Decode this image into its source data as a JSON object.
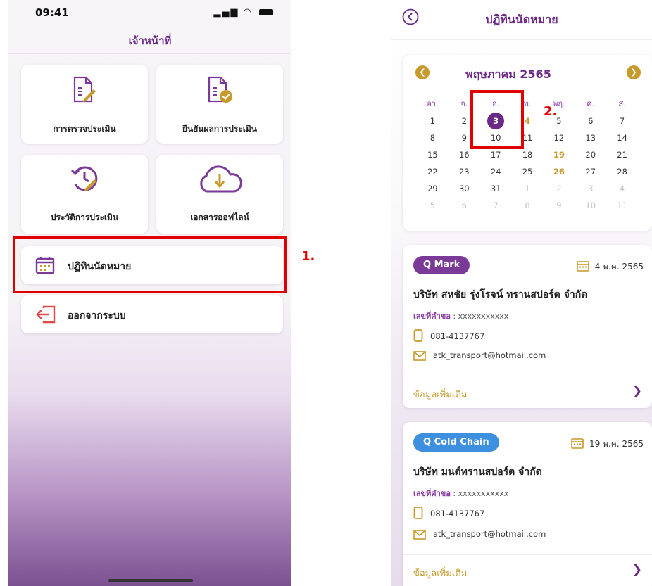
{
  "left": {
    "status_time": "09:41",
    "status_icons": "signal-wifi-battery",
    "header_title": "เจ้าหน้าที่",
    "tiles": [
      {
        "label": "การตรวจประเมิน",
        "icon": "document-edit-icon"
      },
      {
        "label": "ยืนยันผลการประเมิน",
        "icon": "document-check-icon"
      },
      {
        "label": "ประวัติการประเมิน",
        "icon": "history-icon"
      },
      {
        "label": "เอกสารออฟไลน์",
        "icon": "cloud-download-icon"
      }
    ],
    "menu": [
      {
        "label": "ปฏิทินนัดหมาย",
        "icon": "calendar-icon"
      },
      {
        "label": "ออกจากระบบ",
        "icon": "logout-icon"
      }
    ],
    "step_label": "1."
  },
  "right": {
    "header_title": "ปฏิทินนัดหมาย",
    "calendar": {
      "month_title": "พฤษภาคม 2565",
      "weekdays": [
        "อา.",
        "จ.",
        "อ.",
        "พ.",
        "พฤ.",
        "ศ.",
        "ส."
      ],
      "weeks": [
        [
          "1",
          "2",
          "3",
          "4",
          "5",
          "6",
          "7"
        ],
        [
          "8",
          "9",
          "10",
          "11",
          "12",
          "13",
          "14"
        ],
        [
          "15",
          "16",
          "17",
          "18",
          "19",
          "20",
          "21"
        ],
        [
          "22",
          "23",
          "24",
          "25",
          "26",
          "27",
          "28"
        ],
        [
          "29",
          "30",
          "31",
          "1",
          "2",
          "3",
          "4"
        ],
        [
          "5",
          "6",
          "7",
          "8",
          "9",
          "10",
          "11"
        ]
      ],
      "selected_day": "3",
      "event_days": [
        "4",
        "19",
        "26"
      ],
      "step_label": "2."
    },
    "appointments": [
      {
        "badge": "Q Mark",
        "badge_color": "#7b3a98",
        "date": "4 พ.ค. 2565",
        "company": "บริษัท สหชัย รุ่งโรจน์ ทรานสปอร์ต จำกัด",
        "request_label": "เลขที่คำขอ",
        "request_value": " : xxxxxxxxxxx",
        "phone": "081-4137767",
        "email": "atk_transport@hotmail.com",
        "more": "ข้อมูลเพิ่มเติม"
      },
      {
        "badge": "Q Cold Chain",
        "badge_color": "#3d8fe0",
        "date": "19 พ.ค. 2565",
        "company": "บริษัท มนต์ทรานสปอร์ต จำกัด",
        "request_label": "เลขที่คำขอ",
        "request_value": " : xxxxxxxxxxx",
        "phone": "081-4137767",
        "email": "atk_transport@hotmail.com",
        "more": "ข้อมูลเพิ่มเติม"
      }
    ]
  },
  "colors": {
    "primary_purple": "#6b2a86",
    "gold": "#c79a2b",
    "highlight_red": "#e00000"
  }
}
